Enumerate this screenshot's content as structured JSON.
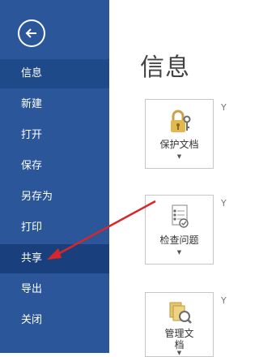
{
  "sidebar": {
    "items": [
      {
        "label": "信息"
      },
      {
        "label": "新建"
      },
      {
        "label": "打开"
      },
      {
        "label": "保存"
      },
      {
        "label": "另存为"
      },
      {
        "label": "打印"
      },
      {
        "label": "共享"
      },
      {
        "label": "导出"
      },
      {
        "label": "关闭"
      }
    ]
  },
  "main": {
    "title": "信息",
    "cards": [
      {
        "label": "保护文档",
        "icon": "lock-key-icon"
      },
      {
        "label": "检查问题",
        "icon": "checklist-icon"
      },
      {
        "label_line1": "管理文",
        "label_line2": "档",
        "icon": "manage-docs-icon"
      }
    ],
    "edge_text": [
      "Y",
      "Y",
      "Y"
    ]
  },
  "colors": {
    "sidebar_bg": "#2b579a",
    "active_item": "#1f4a8a",
    "arrow": "#d9262a"
  }
}
